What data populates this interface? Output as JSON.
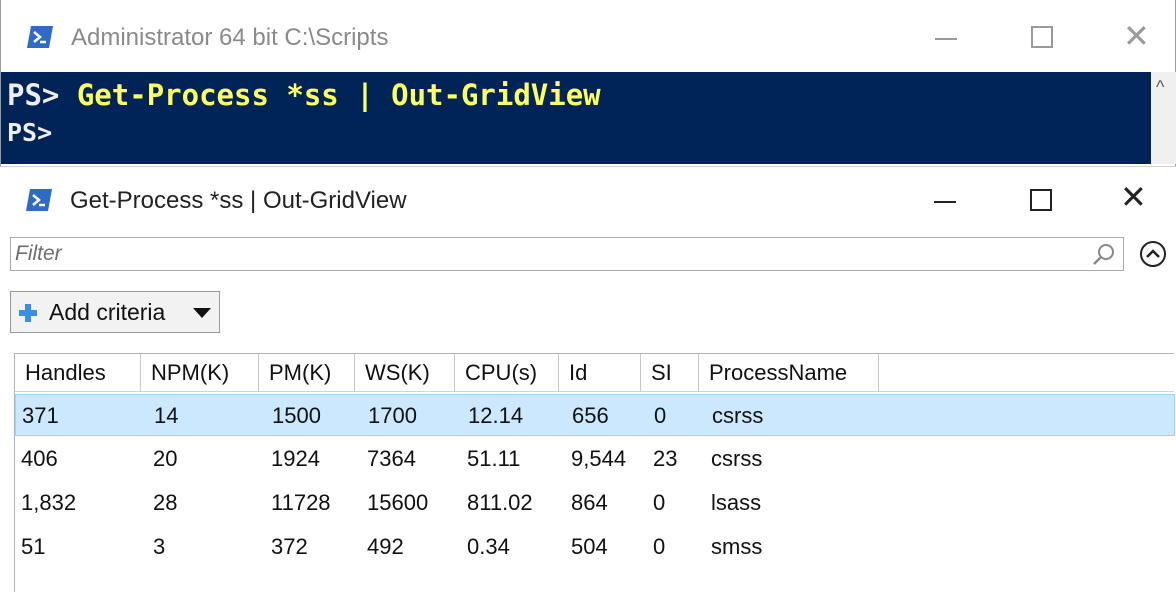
{
  "ps_window": {
    "title": "Administrator 64 bit C:\\Scripts",
    "console_lines": [
      {
        "prompt": "PS>",
        "command": " Get-Process *ss | Out-GridView"
      },
      {
        "prompt": "PS>",
        "command": ""
      }
    ]
  },
  "gridview_window": {
    "title": "Get-Process *ss | Out-GridView",
    "filter": {
      "placeholder": "Filter",
      "value": ""
    },
    "add_criteria_label": "Add criteria",
    "columns": [
      "Handles",
      "NPM(K)",
      "PM(K)",
      "WS(K)",
      "CPU(s)",
      "Id",
      "SI",
      "ProcessName"
    ],
    "rows": [
      [
        "371",
        "14",
        "1500",
        "1700",
        "12.14",
        "656",
        "0",
        "csrss"
      ],
      [
        "406",
        "20",
        "1924",
        "7364",
        "51.11",
        "9,544",
        "23",
        "csrss"
      ],
      [
        "1,832",
        "28",
        "11728",
        "15600",
        "811.02",
        "864",
        "0",
        "lsass"
      ],
      [
        "51",
        "3",
        "372",
        "492",
        "0.34",
        "504",
        "0",
        "smss"
      ]
    ],
    "selected_row": 0
  },
  "colors": {
    "console_bg": "#012456",
    "command_text": "#ffff60",
    "selection_bg": "#cce8ff"
  },
  "icons": [
    "powershell-icon",
    "minimize-icon",
    "maximize-icon",
    "close-icon",
    "search-icon",
    "collapse-up-icon",
    "plus-icon",
    "chevron-down-icon"
  ]
}
